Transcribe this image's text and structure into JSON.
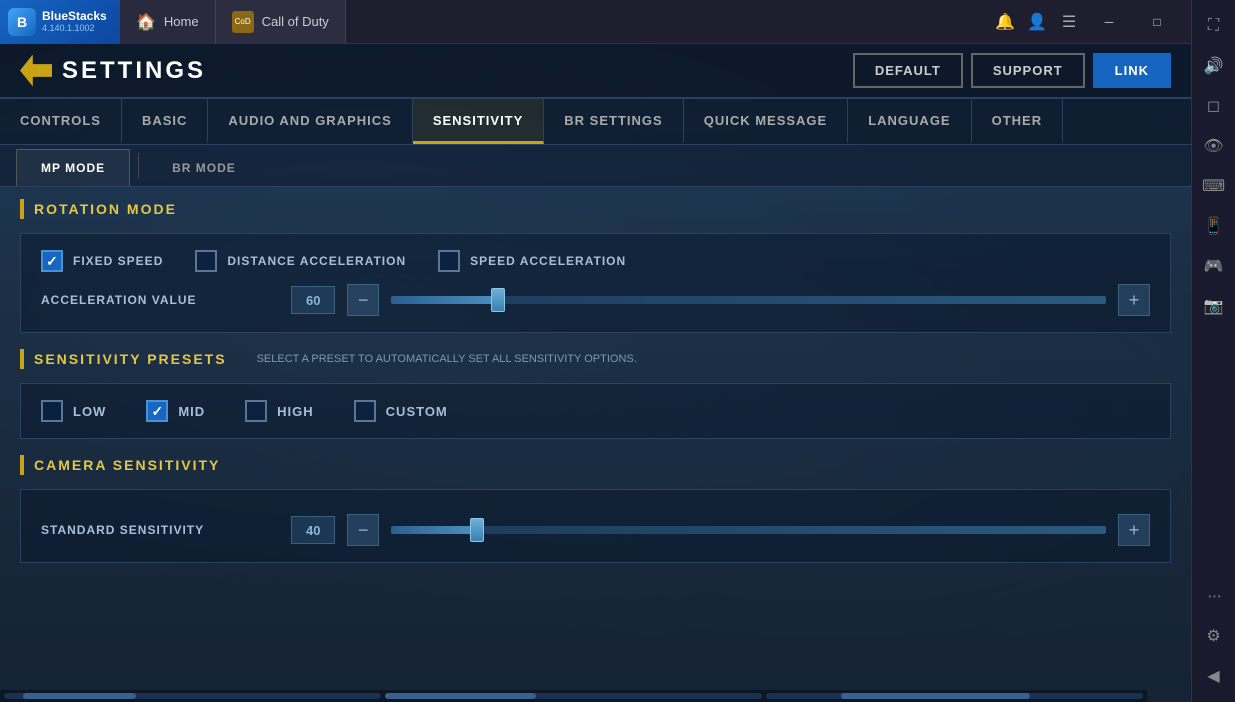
{
  "app": {
    "name": "BlueStacks",
    "version": "4.140.1.1002",
    "logo_text": "BlueStacks",
    "logo_sub": "4.140.1.1002"
  },
  "titlebar": {
    "home_tab": "Home",
    "cod_tab": "Call of Duty",
    "btn_back": "◀",
    "btn_notification": "🔔",
    "btn_account": "👤",
    "btn_menu": "☰",
    "btn_minimize": "─",
    "btn_restore": "□",
    "btn_close": "✕",
    "btn_expand": "⛶"
  },
  "right_sidebar": {
    "icons": [
      "🔊",
      "⛶",
      "👁",
      "⌨",
      "📱",
      "🎮",
      "📷",
      "⚙",
      "◀"
    ]
  },
  "settings": {
    "title": "SETTINGS",
    "buttons": {
      "default": "DEFAULT",
      "support": "SUPPORT",
      "link": "LINK"
    },
    "tabs": [
      {
        "id": "controls",
        "label": "CONTROLS"
      },
      {
        "id": "basic",
        "label": "BASIC"
      },
      {
        "id": "audio_graphics",
        "label": "AUDIO AND GRAPHICS"
      },
      {
        "id": "sensitivity",
        "label": "SENSITIVITY",
        "active": true
      },
      {
        "id": "br_settings",
        "label": "BR SETTINGS"
      },
      {
        "id": "quick_message",
        "label": "QUICK MESSAGE"
      },
      {
        "id": "language",
        "label": "LANGUAGE"
      },
      {
        "id": "other",
        "label": "OTHER"
      }
    ],
    "sub_tabs": [
      {
        "id": "mp_mode",
        "label": "MP MODE",
        "active": true
      },
      {
        "id": "br_mode",
        "label": "BR MODE"
      }
    ],
    "sections": {
      "rotation_mode": {
        "title": "ROTATION MODE",
        "options": {
          "fixed_speed": {
            "label": "FIXED SPEED",
            "checked": true
          },
          "distance_acceleration": {
            "label": "DISTANCE ACCELERATION",
            "checked": false
          },
          "speed_acceleration": {
            "label": "SPEED ACCELERATION",
            "checked": false
          }
        },
        "acceleration_value": {
          "label": "ACCELERATION VALUE",
          "value": "60",
          "fill_percent": 15
        }
      },
      "sensitivity_presets": {
        "title": "SENSITIVITY PRESETS",
        "note": "SELECT A PRESET TO AUTOMATICALLY SET ALL SENSITIVITY OPTIONS.",
        "options": {
          "low": {
            "label": "LOW",
            "checked": false
          },
          "mid": {
            "label": "MID",
            "checked": true
          },
          "high": {
            "label": "HIGH",
            "checked": false
          },
          "custom": {
            "label": "CUSTOM",
            "checked": false
          }
        }
      },
      "camera_sensitivity": {
        "title": "CAMERA SENSITIVITY",
        "standard_sensitivity": {
          "label": "STANDARD SENSITIVITY",
          "value": "40",
          "fill_percent": 12
        }
      }
    }
  }
}
